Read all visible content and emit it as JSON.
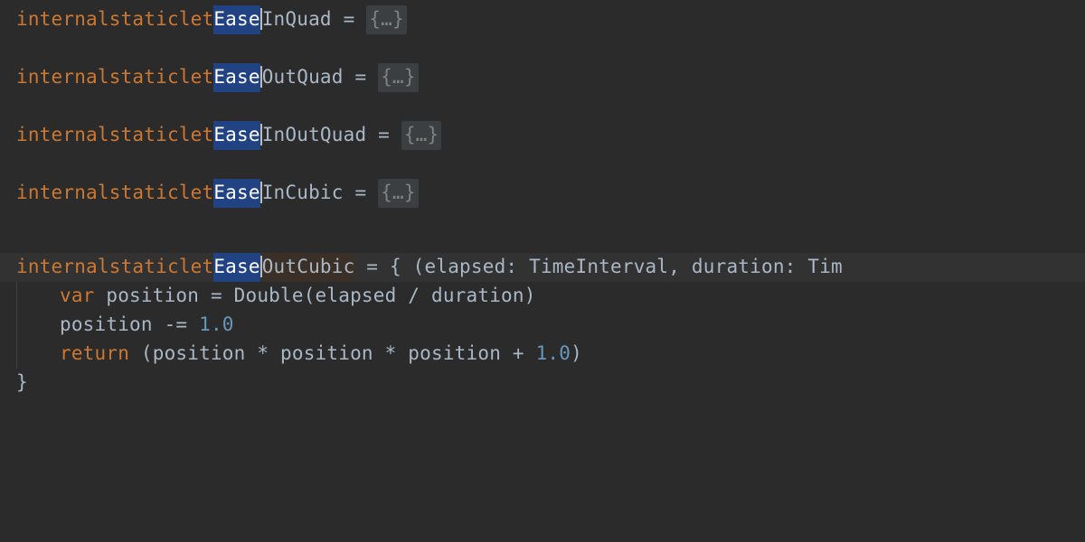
{
  "kw_internal": "internal",
  "kw_static": "static",
  "kw_let": "let",
  "kw_var": "var",
  "kw_return": "return",
  "highlight": "Ease",
  "lines": [
    {
      "rest": "InQuad",
      "eq": " = ",
      "fold": "{…}"
    },
    {
      "rest": "OutQuad",
      "eq": " = ",
      "fold": "{…}"
    },
    {
      "rest": "InOutQuad",
      "eq": " = ",
      "fold": "{…}"
    },
    {
      "rest": "InCubic",
      "eq": " = ",
      "fold": "{…}"
    }
  ],
  "expanded": {
    "rest": "OutCubic",
    "sig": " = { (elapsed: TimeInterval, duration: Tim",
    "body1_var": "var",
    "body1_rest": " position = Double(elapsed / duration)",
    "body2": "position -= ",
    "body2_num": "1.0",
    "body3_ret": "return",
    "body3_mid": " (position * position * position + ",
    "body3_num": "1.0",
    "body3_close": ")",
    "close": "}"
  }
}
